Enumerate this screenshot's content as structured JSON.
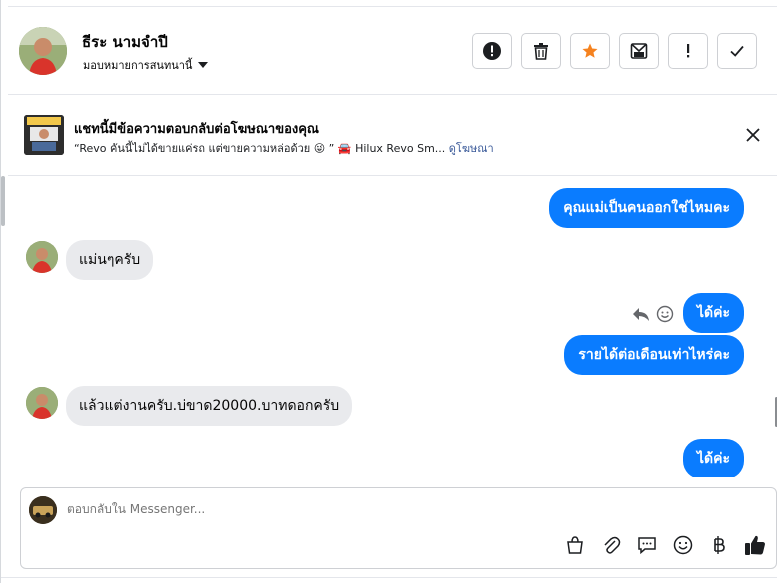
{
  "header": {
    "contact_name": "ธีระ นามจำปี",
    "assign_label": "มอบหมายการสนทนานี้",
    "icons": [
      "alert-circle-icon",
      "trash-icon",
      "star-icon",
      "mark-unread-icon",
      "exclamation-icon",
      "checkmark-icon"
    ],
    "colors": {
      "star": "#f5821f"
    }
  },
  "ad_banner": {
    "title": "แชทนี้มีข้อความตอบกลับต่อโฆษณาของคุณ",
    "quote": "“Revo คันนี้ไม่ได้ขายแค่รถ แต่ขายความหล่อด้วย 😜 ” 🚘 Hilux Revo Sm...",
    "link": "ดูโฆษณา"
  },
  "messages": [
    {
      "side": "out",
      "text": "คุณแม่เป็นคนออกใช่ไหมคะ"
    },
    {
      "side": "in",
      "text": "แม่นๆครับ"
    },
    {
      "side": "out",
      "text": "ได้ค่ะ"
    },
    {
      "side": "out",
      "text": "รายได้ต่อเดือนเท่าไหร่คะ"
    },
    {
      "side": "in",
      "text": "แล้วแต่งานครับ.บ่ขาด20000.บาทดอกครับ"
    },
    {
      "side": "out",
      "text": "ได้ค่ะ"
    }
  ],
  "composer": {
    "placeholder": "ตอบกลับใน Messenger...",
    "tools": [
      "shopping-bag-icon",
      "paperclip-icon",
      "saved-reply-icon",
      "emoji-icon",
      "baht-icon",
      "thumbs-up-icon"
    ]
  },
  "colors": {
    "outgoing_bubble": "#0a7cff",
    "incoming_bubble": "#e9eaed",
    "link": "#385898"
  }
}
